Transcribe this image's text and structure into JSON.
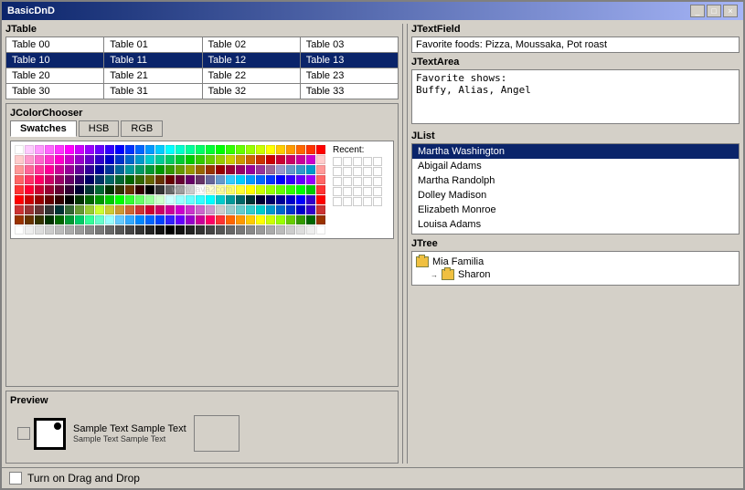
{
  "window": {
    "title": "BasicDnD",
    "controls": [
      "minimize",
      "maximize",
      "close"
    ]
  },
  "jtable": {
    "label": "JTable",
    "rows": [
      [
        "Table 00",
        "Table 01",
        "Table 02",
        "Table 03"
      ],
      [
        "Table 10",
        "Table 11",
        "Table 12",
        "Table 13"
      ],
      [
        "Table 20",
        "Table 21",
        "Table 22",
        "Table 23"
      ],
      [
        "Table 30",
        "Table 31",
        "Table 32",
        "Table 33"
      ]
    ],
    "selected_row": 1
  },
  "color_chooser": {
    "label": "JColorChooser",
    "tabs": [
      "Swatches",
      "HSB",
      "RGB"
    ],
    "active_tab": "Swatches",
    "recent_label": "Recent:"
  },
  "preview": {
    "label": "Preview",
    "sample_text": "Sample Text  Sample Text",
    "sample_text_small": "Sample Text Sample Text"
  },
  "jtextfield": {
    "label": "JTextField",
    "value": "Favorite foods: Pizza, Moussaka, Pot roast"
  },
  "jtextarea": {
    "label": "JTextArea",
    "value": "Favorite shows:\nBuffy, Alias, Angel"
  },
  "jlist": {
    "label": "JList",
    "items": [
      "Martha Washington",
      "Abigail Adams",
      "Martha Randolph",
      "Dolley Madison",
      "Elizabeth Monroe",
      "Louisa Adams"
    ],
    "selected_index": 0
  },
  "jtree": {
    "label": "JTree",
    "nodes": [
      {
        "name": "Mia Familia",
        "type": "folder",
        "indent": 0
      },
      {
        "name": "Sharon",
        "type": "folder",
        "indent": 1
      }
    ]
  },
  "bottom": {
    "checkbox_label": "Turn on Drag and Drop"
  }
}
